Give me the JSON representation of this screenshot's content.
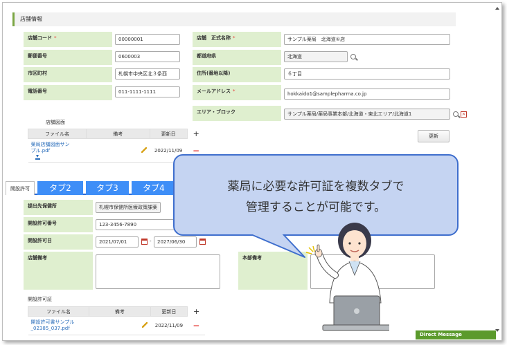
{
  "store": {
    "section_title": "店舗情報",
    "code_label": "店舗コード",
    "code_value": "00000001",
    "postal_label": "郵便番号",
    "postal_value": "0600003",
    "city_label": "市区町村",
    "city_value": "札幌市中央区北３条西",
    "phone_label": "電話番号",
    "phone_value": "011-1111-1111",
    "name_label": "店舗　正式名称",
    "name_value": "サンプル薬局　北海道①店",
    "pref_label": "都道府県",
    "pref_value": "北海道",
    "address_label": "住所(番地以降)",
    "address_value": "６丁目",
    "email_label": "メールアドレス",
    "email_value": "hokkaido1@samplepharma.co.jp",
    "area_label": "エリア・ブロック",
    "area_value": "サンプル薬局/薬局事業本部/北海道・東北エリア/北海道1",
    "required_mark": "*",
    "update_button": "更新"
  },
  "floor_plan": {
    "title": "店舗図面",
    "headers": [
      "ファイル名",
      "備考",
      "更新日"
    ],
    "file_name": "薬局店舗図面サンプル.pdf",
    "date": "2022/11/09",
    "plus": "+",
    "minus": "−"
  },
  "tabs": [
    "開設許可",
    "タブ2",
    "タブ3",
    "タブ4"
  ],
  "permit": {
    "health_center_label": "提出先保健所",
    "health_center_value": "札幌市保健所医療政策課薬",
    "permit_no_label": "開設許可番号",
    "permit_no_value": "123-3456-7890",
    "permit_date_label": "開設許可日",
    "date_from": "2021/07/01",
    "date_sep": "-",
    "date_to": "2027/06/30",
    "store_note_label": "店舗備考",
    "hq_note_label": "本部備考"
  },
  "permit_cert": {
    "title": "開設許可証",
    "headers": [
      "ファイル名",
      "備考",
      "更新日"
    ],
    "file_name": "開設許可書サンプル_02385_037.pdf",
    "date": "2022/11/09",
    "plus": "+",
    "minus": "−"
  },
  "balloon": {
    "line1": "薬局に必要な許可証を複数タブで",
    "line2": "管理することが可能です。"
  },
  "direct_message": "Direct Message",
  "colors": {
    "label_bg": "#dfefcf",
    "tab_blue": "#3e8ef7",
    "balloon_fill": "#c5d4f2",
    "balloon_border": "#3e6ecd",
    "dm_green": "#5b9a2c"
  }
}
